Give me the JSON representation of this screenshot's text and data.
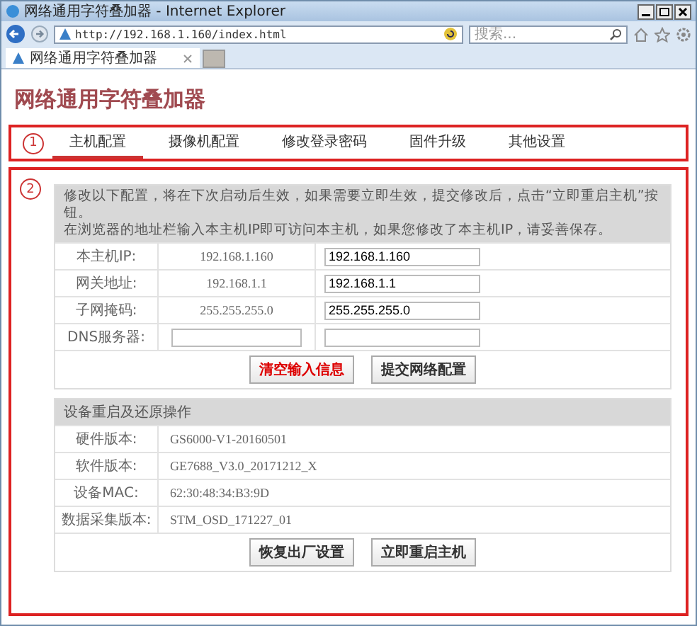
{
  "window": {
    "title": "网络通用字符叠加器 - Internet Explorer"
  },
  "address_bar": {
    "url": "http://192.168.1.160/index.html"
  },
  "search": {
    "placeholder": "搜索..."
  },
  "browser_tabs": [
    {
      "label": "网络通用字符叠加器",
      "selected": true
    }
  ],
  "page": {
    "title": "网络通用字符叠加器"
  },
  "nav": {
    "marker": "1",
    "tabs": [
      {
        "label": "主机配置",
        "selected": true
      },
      {
        "label": "摄像机配置",
        "selected": false
      },
      {
        "label": "修改登录密码",
        "selected": false
      },
      {
        "label": "固件升级",
        "selected": false
      },
      {
        "label": "其他设置",
        "selected": false
      }
    ]
  },
  "content": {
    "marker": "2"
  },
  "network": {
    "notes": [
      "修改以下配置，将在下次启动后生效，如果需要立即生效，提交修改后，点击“立即重启主机”按钮。",
      "在浏览器的地址栏输入本主机IP即可访问本主机，如果您修改了本主机IP，请妥善保存。"
    ],
    "rows": [
      {
        "kind": "text",
        "label": "本主机IP:",
        "current": "192.168.1.160",
        "value": "192.168.1.160"
      },
      {
        "kind": "text",
        "label": "网关地址:",
        "current": "192.168.1.1",
        "value": "192.168.1.1"
      },
      {
        "kind": "text",
        "label": "子网掩码:",
        "current": "255.255.255.0",
        "value": "255.255.255.0"
      },
      {
        "kind": "inputs",
        "label": "DNS服务器:"
      }
    ],
    "buttons": [
      {
        "label": "清空输入信息",
        "kind": "danger"
      },
      {
        "label": "提交网络配置",
        "kind": "normal"
      }
    ]
  },
  "device": {
    "title": "设备重启及还原操作",
    "rows": [
      {
        "label": "硬件版本:",
        "value": "GS6000-V1-20160501"
      },
      {
        "label": "软件版本:",
        "value": "GE7688_V3.0_20171212_X"
      },
      {
        "label": "设备MAC:",
        "value": "62:30:48:34:B3:9D"
      },
      {
        "label": "数据采集版本:",
        "value": "STM_OSD_171227_01"
      }
    ],
    "buttons": [
      "恢复出厂设置",
      "立即重启主机"
    ]
  }
}
